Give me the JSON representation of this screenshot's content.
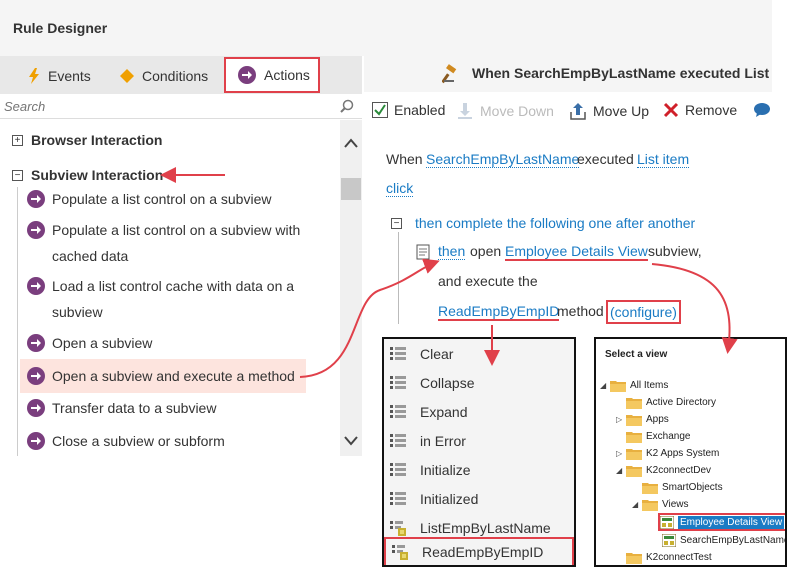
{
  "app": {
    "title": "Rule Designer"
  },
  "tabs": {
    "events": "Events",
    "conditions": "Conditions",
    "actions": "Actions"
  },
  "search": {
    "placeholder": "Search"
  },
  "groups": {
    "browser": "Browser Interaction",
    "subview": "Subview Interaction"
  },
  "actions": [
    "Populate a list control on a subview",
    "Populate a list control on a subview with cached data",
    "Load a list control cache with data on a subview",
    "Open a subview",
    "Open a subview and execute a method",
    "Transfer data to a subview",
    "Close a subview or subform"
  ],
  "rule": {
    "title": "When SearchEmpByLastName executed List ite",
    "when": "When",
    "source": "SearchEmpByLastName",
    "executed": "executed",
    "event": "List item",
    "click": "click",
    "then_complete": "then complete the following one after another",
    "then": "then",
    "open": "open",
    "view": "Employee Details View",
    "subview": "subview,",
    "and_execute": "and execute the",
    "method": "ReadEmpByEmpID",
    "method_word": "method",
    "configure": "(configure)"
  },
  "toolbar": {
    "enabled": "Enabled",
    "move_down": "Move Down",
    "move_up": "Move Up",
    "remove": "Remove"
  },
  "methods": [
    "Clear",
    "Collapse",
    "Expand",
    "in Error",
    "Initialize",
    "Initialized",
    "ListEmpByLastName",
    "ReadEmpByEmpID"
  ],
  "view_picker": {
    "title": "Select a view",
    "nodes": [
      "All Items",
      "Active Directory",
      "Apps",
      "Exchange",
      "K2 Apps System",
      "K2connectDev",
      "SmartObjects",
      "Views",
      "Employee Details View",
      "SearchEmpByLastName",
      "K2connectTest"
    ]
  },
  "colors": {
    "accent_red": "#e0404a",
    "link_blue": "#1a7bc4",
    "action_purple": "#7a3e7e"
  }
}
